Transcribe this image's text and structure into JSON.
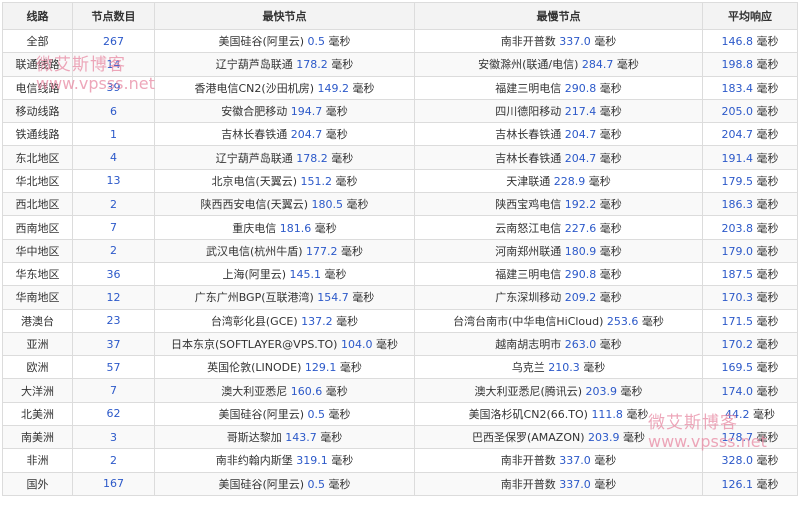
{
  "headers": {
    "route": "线路",
    "node_count": "节点数目",
    "fastest": "最快节点",
    "slowest": "最慢节点",
    "avg": "平均响应"
  },
  "unit": "毫秒",
  "rows": [
    {
      "route": "全部",
      "count": "267",
      "fast_name": "美国硅谷(阿里云)",
      "fast_val": "0.5",
      "slow_name": "南非开普数",
      "slow_val": "337.0",
      "avg": "146.8"
    },
    {
      "route": "联通线路",
      "count": "14",
      "fast_name": "辽宁葫芦岛联通",
      "fast_val": "178.2",
      "slow_name": "安徽滁州(联通/电信)",
      "slow_val": "284.7",
      "avg": "198.8"
    },
    {
      "route": "电信线路",
      "count": "39",
      "fast_name": "香港电信CN2(沙田机房)",
      "fast_val": "149.2",
      "slow_name": "福建三明电信",
      "slow_val": "290.8",
      "avg": "183.4"
    },
    {
      "route": "移动线路",
      "count": "6",
      "fast_name": "安徽合肥移动",
      "fast_val": "194.7",
      "slow_name": "四川德阳移动",
      "slow_val": "217.4",
      "avg": "205.0"
    },
    {
      "route": "铁通线路",
      "count": "1",
      "fast_name": "吉林长春铁通",
      "fast_val": "204.7",
      "slow_name": "吉林长春铁通",
      "slow_val": "204.7",
      "avg": "204.7"
    },
    {
      "route": "东北地区",
      "count": "4",
      "fast_name": "辽宁葫芦岛联通",
      "fast_val": "178.2",
      "slow_name": "吉林长春铁通",
      "slow_val": "204.7",
      "avg": "191.4"
    },
    {
      "route": "华北地区",
      "count": "13",
      "fast_name": "北京电信(天翼云)",
      "fast_val": "151.2",
      "slow_name": "天津联通",
      "slow_val": "228.9",
      "avg": "179.5"
    },
    {
      "route": "西北地区",
      "count": "2",
      "fast_name": "陕西西安电信(天翼云)",
      "fast_val": "180.5",
      "slow_name": "陕西宝鸡电信",
      "slow_val": "192.2",
      "avg": "186.3"
    },
    {
      "route": "西南地区",
      "count": "7",
      "fast_name": "重庆电信",
      "fast_val": "181.6",
      "slow_name": "云南怒江电信",
      "slow_val": "227.6",
      "avg": "203.8"
    },
    {
      "route": "华中地区",
      "count": "2",
      "fast_name": "武汉电信(杭州牛盾)",
      "fast_val": "177.2",
      "slow_name": "河南郑州联通",
      "slow_val": "180.9",
      "avg": "179.0"
    },
    {
      "route": "华东地区",
      "count": "36",
      "fast_name": "上海(阿里云)",
      "fast_val": "145.1",
      "slow_name": "福建三明电信",
      "slow_val": "290.8",
      "avg": "187.5"
    },
    {
      "route": "华南地区",
      "count": "12",
      "fast_name": "广东广州BGP(互联港湾)",
      "fast_val": "154.7",
      "slow_name": "广东深圳移动",
      "slow_val": "209.2",
      "avg": "170.3"
    },
    {
      "route": "港澳台",
      "count": "23",
      "fast_name": "台湾彰化县(GCE)",
      "fast_val": "137.2",
      "slow_name": "台湾台南市(中华电信HiCloud)",
      "slow_val": "253.6",
      "avg": "171.5"
    },
    {
      "route": "亚洲",
      "count": "37",
      "fast_name": "日本东京(SOFTLAYER@VPS.TO)",
      "fast_val": "104.0",
      "slow_name": "越南胡志明市",
      "slow_val": "263.0",
      "avg": "170.2"
    },
    {
      "route": "欧洲",
      "count": "57",
      "fast_name": "英国伦敦(LINODE)",
      "fast_val": "129.1",
      "slow_name": "乌克兰",
      "slow_val": "210.3",
      "avg": "169.5"
    },
    {
      "route": "大洋洲",
      "count": "7",
      "fast_name": "澳大利亚悉尼",
      "fast_val": "160.6",
      "slow_name": "澳大利亚悉尼(腾讯云)",
      "slow_val": "203.9",
      "avg": "174.0"
    },
    {
      "route": "北美洲",
      "count": "62",
      "fast_name": "美国硅谷(阿里云)",
      "fast_val": "0.5",
      "slow_name": "美国洛杉矶CN2(66.TO)",
      "slow_val": "111.8",
      "avg": "44.2"
    },
    {
      "route": "南美洲",
      "count": "3",
      "fast_name": "哥斯达黎加",
      "fast_val": "143.7",
      "slow_name": "巴西圣保罗(AMAZON)",
      "slow_val": "203.9",
      "avg": "178.7"
    },
    {
      "route": "非洲",
      "count": "2",
      "fast_name": "南非约翰内斯堡",
      "fast_val": "319.1",
      "slow_name": "南非开普数",
      "slow_val": "337.0",
      "avg": "328.0"
    },
    {
      "route": "国外",
      "count": "167",
      "fast_name": "美国硅谷(阿里云)",
      "fast_val": "0.5",
      "slow_name": "南非开普数",
      "slow_val": "337.0",
      "avg": "126.1"
    }
  ],
  "watermark": {
    "cn": "微艾斯博客",
    "en": "www.vpsss.net"
  },
  "colors": {
    "number": "#2c59c9",
    "border": "#dcdcdc",
    "header_bg": "#f3f3f3",
    "watermark": "#e88aa3"
  }
}
